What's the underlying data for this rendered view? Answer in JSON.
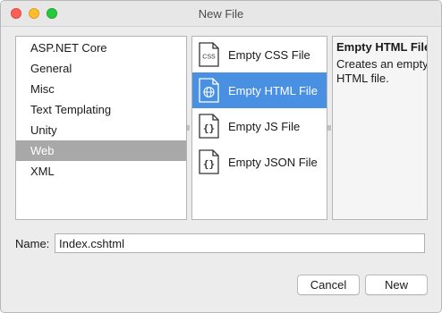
{
  "window": {
    "title": "New File"
  },
  "categories": [
    {
      "label": "ASP.NET Core",
      "selected": false
    },
    {
      "label": "General",
      "selected": false
    },
    {
      "label": "Misc",
      "selected": false
    },
    {
      "label": "Text Templating",
      "selected": false
    },
    {
      "label": "Unity",
      "selected": false
    },
    {
      "label": "Web",
      "selected": true
    },
    {
      "label": "XML",
      "selected": false
    }
  ],
  "templates": [
    {
      "label": "Empty CSS File",
      "icon": "css-file-icon",
      "icon_text": "CSS",
      "selected": false
    },
    {
      "label": "Empty HTML File",
      "icon": "html-file-icon",
      "selected": true
    },
    {
      "label": "Empty JS File",
      "icon": "js-file-icon",
      "icon_text": "{}",
      "selected": false
    },
    {
      "label": "Empty JSON File",
      "icon": "json-file-icon",
      "icon_text": "{}",
      "selected": false
    }
  ],
  "description": {
    "title": "Empty HTML File",
    "text_line1": "Creates an empty",
    "text_line2": "HTML file."
  },
  "name_field": {
    "label": "Name:",
    "value": "Index.cshtml"
  },
  "buttons": {
    "cancel": "Cancel",
    "new": "New"
  },
  "colors": {
    "selection_blue": "#4a90e2",
    "selection_gray": "#a8a8a8"
  }
}
